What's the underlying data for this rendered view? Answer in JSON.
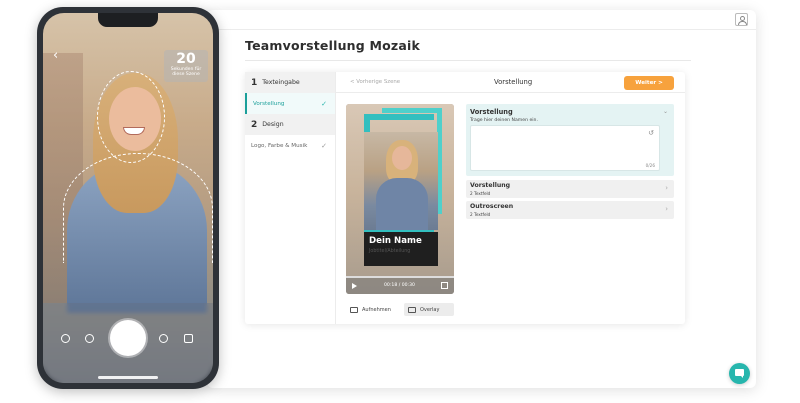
{
  "app": {
    "page_title": "Teamvorstellung Mozaik"
  },
  "steps": {
    "step1": {
      "number": "1",
      "label": "Texteingabe"
    },
    "step1_item": {
      "label": "Vorstellung",
      "check": "✓"
    },
    "step2": {
      "number": "2",
      "label": "Design"
    },
    "step2_item": {
      "label": "Logo, Farbe & Musik",
      "check": "✓"
    }
  },
  "toolbar": {
    "prev_label": "< Vorherige Szene",
    "scene_title": "Vorstellung",
    "next_label": "Weiter >"
  },
  "preview": {
    "name": "Dein Name",
    "subtitle": "Jobtitel/Abteilung",
    "time": "00:18 / 00:30",
    "progress": 0.0
  },
  "preview_buttons": {
    "record_label": "Aufnehmen",
    "overlay_label": "Overlay"
  },
  "accordion": {
    "open": {
      "title": "Vorstellung",
      "instruction": "Trage hier deinen Namen ein.",
      "char_count": "0/26",
      "value": ""
    },
    "items": [
      {
        "title": "Vorstellung",
        "subtitle": "2 Textfeld"
      },
      {
        "title": "Outroscreen",
        "subtitle": "2 Textfeld"
      }
    ]
  },
  "phone": {
    "counter_number": "20",
    "counter_label": "Sekunden für diese Szene"
  },
  "colors": {
    "accent": "#27b6ad",
    "button_orange": "#f7a23d",
    "active_row": "#f1fafa"
  }
}
